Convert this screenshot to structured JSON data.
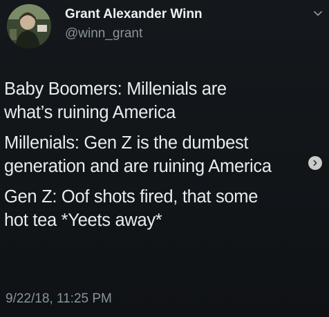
{
  "tweet": {
    "author": {
      "display_name": "Grant Alexander Winn",
      "handle": "@winn_grant"
    },
    "lines": [
      "Baby Boomers: Millenials are\nwhat’s ruining America",
      "Millenials: Gen Z is the dumbest\ngeneration and are ruining America",
      "Gen Z: Oof shots fired, that some\nhot tea *Yeets away*"
    ],
    "timestamp": "9/22/18, 11:25 PM"
  },
  "icons": {
    "menu": "chevron-down-icon",
    "carousel_next": "chevron-right-icon"
  },
  "colors": {
    "background": "#101317",
    "text": "#e9ebed",
    "muted": "#8a949e"
  }
}
